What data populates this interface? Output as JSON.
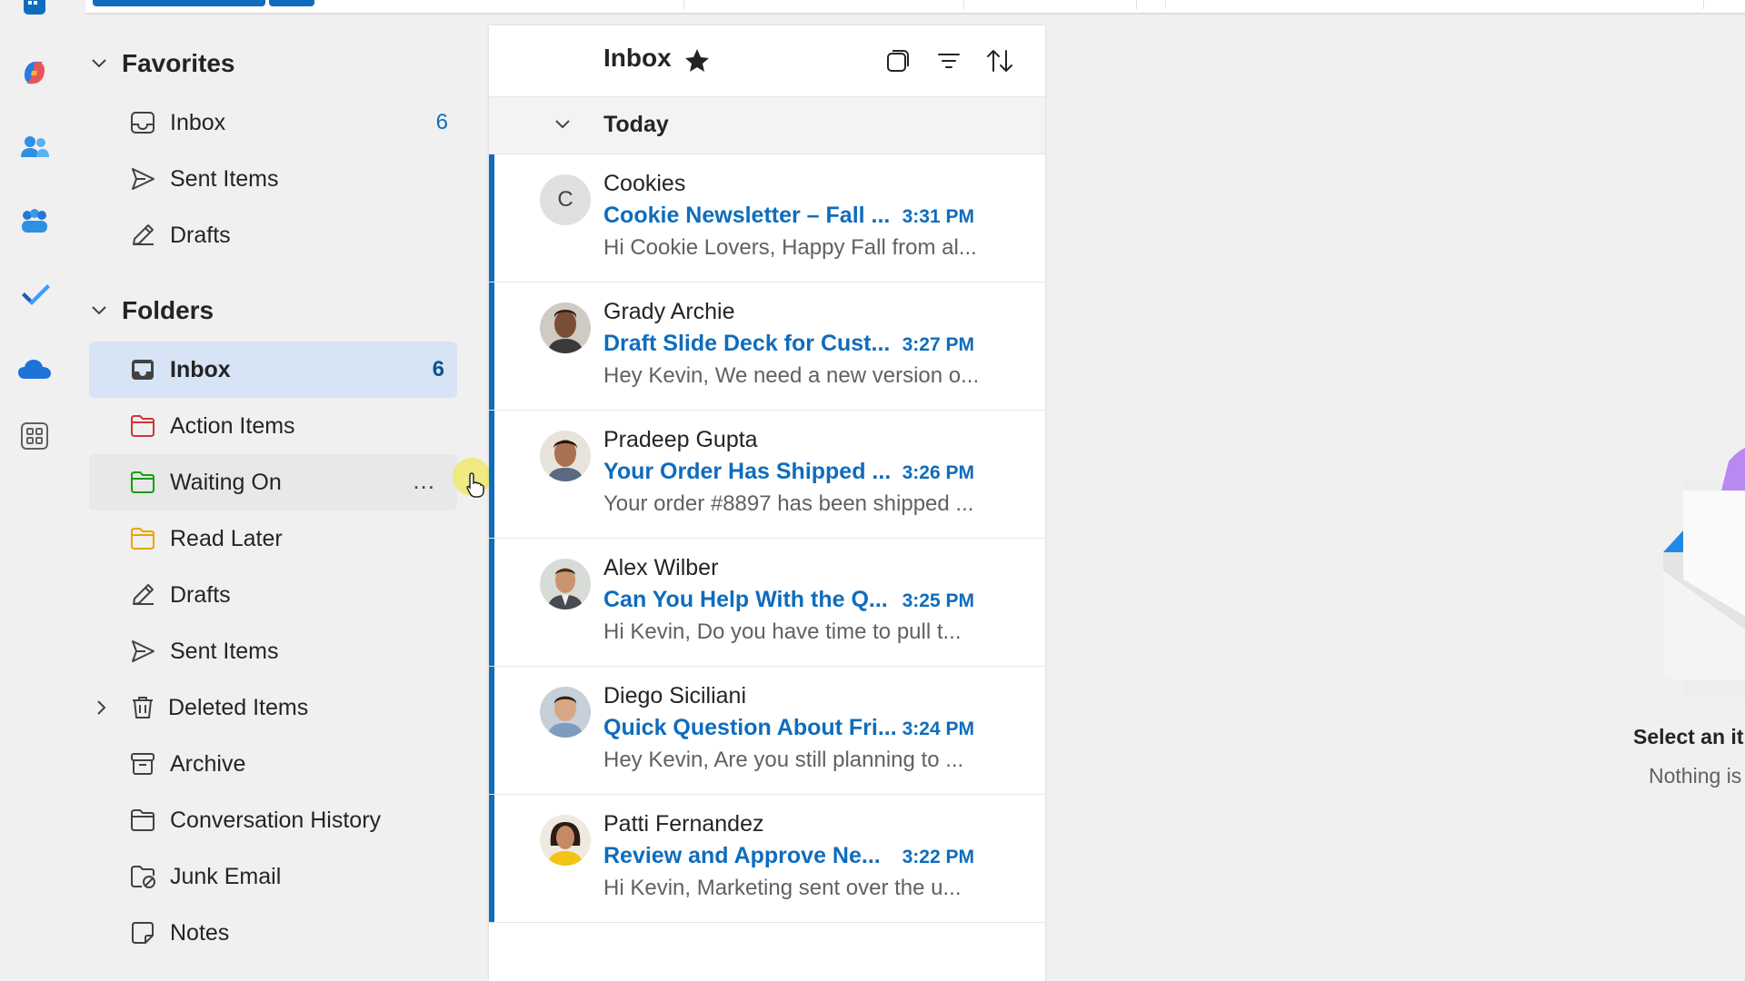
{
  "app_rail": {
    "items": [
      {
        "icon": "calendar-icon"
      },
      {
        "icon": "copilot-icon"
      },
      {
        "icon": "people-icon"
      },
      {
        "icon": "groups-icon"
      },
      {
        "icon": "todo-icon"
      },
      {
        "icon": "onedrive-icon"
      },
      {
        "icon": "more-apps-icon"
      }
    ]
  },
  "favorites": {
    "title": "Favorites",
    "items": [
      {
        "label": "Inbox",
        "count": "6",
        "icon": "inbox-icon"
      },
      {
        "label": "Sent Items",
        "icon": "send-icon"
      },
      {
        "label": "Drafts",
        "icon": "drafts-icon"
      }
    ]
  },
  "folders": {
    "title": "Folders",
    "items": [
      {
        "label": "Inbox",
        "count": "6",
        "icon": "inbox-icon",
        "selected": true
      },
      {
        "label": "Action Items",
        "icon": "folder-icon",
        "color": "#d13438"
      },
      {
        "label": "Waiting On",
        "icon": "folder-icon",
        "color": "#13a10e",
        "more": "..."
      },
      {
        "label": "Read Later",
        "icon": "folder-icon",
        "color": "#eaa300"
      },
      {
        "label": "Drafts",
        "icon": "drafts-icon"
      },
      {
        "label": "Sent Items",
        "icon": "send-icon"
      },
      {
        "label": "Deleted Items",
        "icon": "trash-icon"
      },
      {
        "label": "Archive",
        "icon": "archive-icon"
      },
      {
        "label": "Conversation History",
        "icon": "folder-icon"
      },
      {
        "label": "Junk Email",
        "icon": "junk-icon"
      },
      {
        "label": "Notes",
        "icon": "note-icon"
      }
    ]
  },
  "message_list": {
    "title": "Inbox",
    "group_label": "Today",
    "messages": [
      {
        "sender": "Cookies",
        "avatar_letter": "C",
        "subject": "Cookie Newsletter – Fall ...",
        "time": "3:31 PM",
        "preview": "Hi Cookie Lovers, Happy Fall from al..."
      },
      {
        "sender": "Grady Archie",
        "subject": "Draft Slide Deck for Cust...",
        "time": "3:27 PM",
        "preview": "Hey Kevin, We need a new version o..."
      },
      {
        "sender": "Pradeep Gupta",
        "subject": "Your Order Has Shipped ...",
        "time": "3:26 PM",
        "preview": "Your order #8897 has been shipped ..."
      },
      {
        "sender": "Alex Wilber",
        "subject": "Can You Help With the Q...",
        "time": "3:25 PM",
        "preview": "Hi Kevin, Do you have time to pull t..."
      },
      {
        "sender": "Diego Siciliani",
        "subject": "Quick Question About Fri...",
        "time": "3:24 PM",
        "preview": "Hey Kevin, Are you still planning to ..."
      },
      {
        "sender": "Patti Fernandez",
        "subject": "Review and Approve Ne...",
        "time": "3:22 PM",
        "preview": "Hi Kevin, Marketing sent over the u..."
      }
    ]
  },
  "reading_pane": {
    "title": "Select an it",
    "subtitle": "Nothing is"
  },
  "colors": {
    "accent": "#0f6cbd",
    "selected_bg": "#d6e4f5"
  }
}
